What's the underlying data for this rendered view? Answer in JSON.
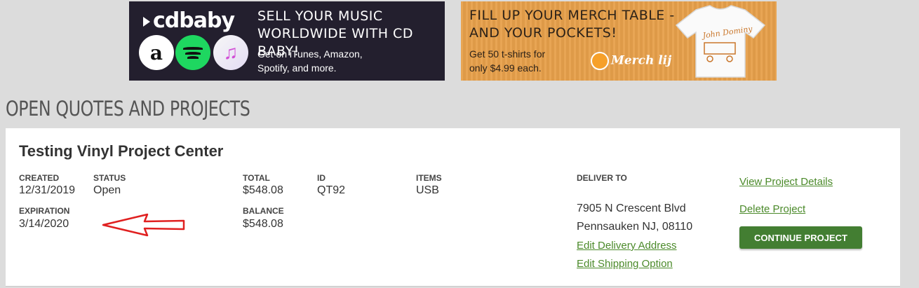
{
  "banners": {
    "cdbaby": {
      "logo": "cdbaby",
      "headline_line1": "SELL YOUR MUSIC",
      "headline_line2": "WORLDWIDE WITH CD BABY!",
      "sub_line1": "Get on iTunes, Amazon,",
      "sub_line2": "Spotify, and more.",
      "icons": [
        "amazon-icon",
        "spotify-icon",
        "itunes-icon"
      ],
      "amazon_glyph": "a",
      "itunes_glyph": "♫"
    },
    "merch": {
      "headline_line1": "FILL UP YOUR MERCH TABLE -",
      "headline_line2": "AND YOUR POCKETS!",
      "sub_line1": "Get 50 t-shirts for",
      "sub_line2": "only $4.99 each.",
      "logo": "Merch lij",
      "shirt_text": "John Dominy"
    }
  },
  "page": {
    "title": "OPEN QUOTES AND PROJECTS"
  },
  "project": {
    "title": "Testing Vinyl Project Center",
    "created_label": "CREATED",
    "created": "12/31/2019",
    "status_label": "STATUS",
    "status": "Open",
    "total_label": "TOTAL",
    "total": "$548.08",
    "id_label": "ID",
    "id": "QT92",
    "items_label": "ITEMS",
    "items": "USB",
    "expiration_label": "EXPIRATION",
    "expiration": "3/14/2020",
    "balance_label": "BALANCE",
    "balance": "$548.08",
    "deliver_label": "DELIVER TO",
    "address_line1": "7905 N Crescent Blvd",
    "address_line2": "Pennsauken NJ, 08110",
    "edit_delivery": "Edit Delivery Address",
    "edit_shipping": "Edit Shipping Option",
    "view_details": "View Project Details",
    "delete_project": "Delete Project",
    "continue": "CONTINUE PROJECT"
  },
  "colors": {
    "link": "#4b8a2a",
    "button": "#437e32",
    "annotation_arrow": "#e02020",
    "page_bg": "#dcdcdc"
  }
}
